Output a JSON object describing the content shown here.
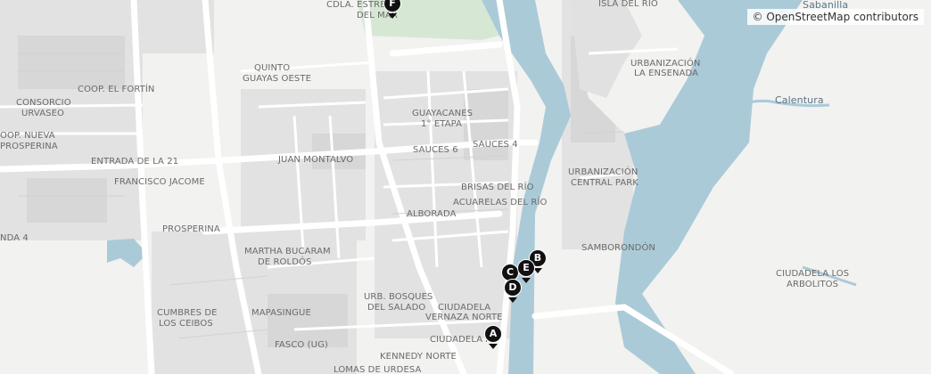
{
  "attribution": "© OpenStreetMap contributors",
  "colors": {
    "water": "#abcad8",
    "land": "#f2f2f0",
    "park": "#d9ead7",
    "road": "#ffffff",
    "block": "#e1e1e1",
    "marker": "#111111"
  },
  "labels": {
    "cdla_estrella": "CDLA. ESTRE",
    "del_mar": "DEL MAR",
    "isla_del_rio": "ISLA DEL RÍO",
    "sabanilla": "Sabanilla",
    "quinto": "QUINTO",
    "guayas_oeste": "GUAYAS OESTE",
    "urb_ensenada_1": "URBANIZACIÓN",
    "urb_ensenada_2": "LA ENSENADA",
    "coop_fortin": "COOP. EL FORTÍN",
    "consorcio_1": "CONSORCIO",
    "consorcio_2": "URVASEO",
    "calentura": "Calentura",
    "guayacanes_1": "GUAYACANES",
    "guayacanes_2": "1° ETAPA",
    "coop_nueva_1": "OOP. NUEVA",
    "coop_nueva_2": "PROSPERINA",
    "sauces_4": "SAUCES 4",
    "sauces_6": "SAUCES 6",
    "entrada_21": "ENTRADA DE LA 21",
    "juan_montalvo": "JUAN MONTALVO",
    "urb_central_1": "URBANIZACIÓN",
    "urb_central_2": "CENTRAL PARK",
    "francisco_jacome": "FRANCISCO JACOME",
    "brisas": "BRISAS DEL RÍO",
    "acuarelas": "ACUARELAS DEL RÍO",
    "alborada": "ALBORADA",
    "prosperina": "PROSPERINA",
    "nda_4": "NDA 4",
    "samborondon": "SAMBORONDÓN",
    "martha_1": "MARTHA BUCARAM",
    "martha_2": "DE ROLDÓS",
    "ciudadela_arbolitos_1": "CIUDADELA LOS",
    "ciudadela_arbolitos_2": "ARBOLITOS",
    "urb_bosques_1": "URB. BOSQUES",
    "urb_bosques_2": "DEL SALADO",
    "ciudadela_vernaza_1": "CIUDADELA",
    "ciudadela_vernaza_2": "VERNAZA NORTE",
    "cumbres_1": "CUMBRES DE",
    "cumbres_2": "LOS CEIBOS",
    "mapasingue": "MAPASINGUE",
    "fasco": "FASCO (UG)",
    "ciudadela_atar": "CIUDADELA A",
    "kennedy": "KENNEDY NORTE",
    "lomas": "LOMAS DE URDESA"
  },
  "markers": [
    {
      "id": "A",
      "label": "A"
    },
    {
      "id": "B",
      "label": "B"
    },
    {
      "id": "C",
      "label": "C"
    },
    {
      "id": "D",
      "label": "D"
    },
    {
      "id": "E",
      "label": "E"
    },
    {
      "id": "F",
      "label": "F"
    }
  ]
}
